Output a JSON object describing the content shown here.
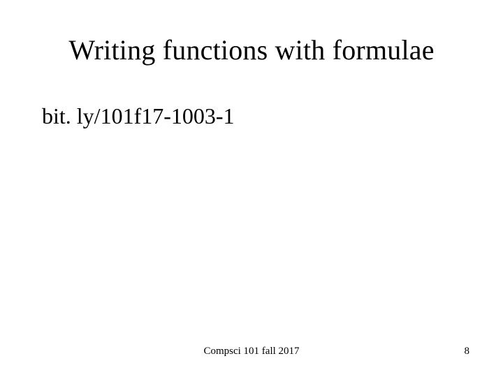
{
  "slide": {
    "title": "Writing functions with formulae",
    "link_text": "bit. ly/101f17-1003-1",
    "footer_center": "Compsci 101 fall 2017",
    "page_number": "8"
  }
}
